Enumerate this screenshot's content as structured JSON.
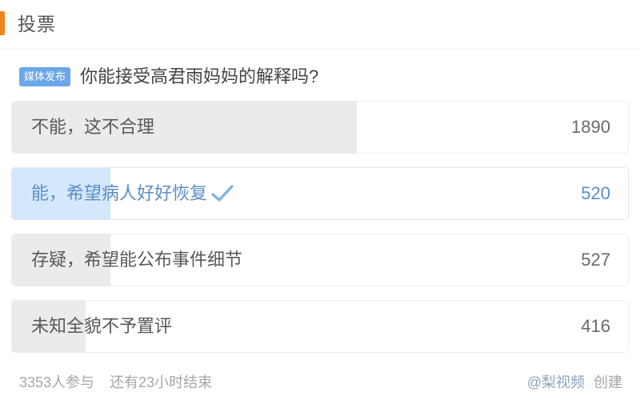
{
  "header": {
    "title": "投票",
    "accent_color": "#f08519"
  },
  "question": {
    "badge": "媒体发布",
    "badge_color": "#6ba7e8",
    "text": "你能接受高君雨妈妈的解释吗?"
  },
  "options": [
    {
      "label": "不能，这不合理",
      "count": "1890",
      "fill_percent": 56,
      "selected": false
    },
    {
      "label": "能，希望病人好好恢复",
      "count": "520",
      "fill_percent": 16,
      "selected": true
    },
    {
      "label": "存疑，希望能公布事件细节",
      "count": "527",
      "fill_percent": 16,
      "selected": false
    },
    {
      "label": "未知全貌不予置评",
      "count": "416",
      "fill_percent": 12,
      "selected": false
    }
  ],
  "footer": {
    "participants": "3353人参与",
    "remaining": "还有23小时结束",
    "author": "@梨视频",
    "created_label": "创建"
  },
  "colors": {
    "selected_text": "#5b8fc7",
    "selected_fill": "#d3e8fb",
    "bar_fill": "#ebebeb",
    "check": "#7cb3e8"
  }
}
